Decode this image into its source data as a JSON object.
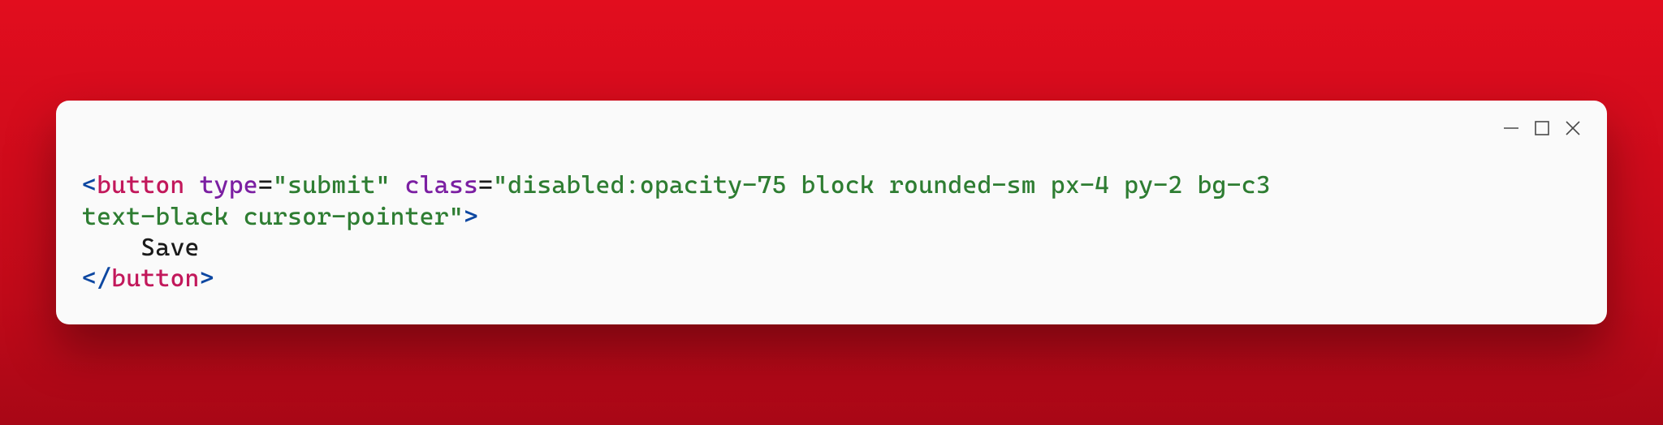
{
  "code": {
    "line1": {
      "open_angle": "<",
      "tag": "button",
      "space1": " ",
      "attr1_name": "type",
      "eq1": "=",
      "attr1_value": "\"submit\"",
      "space2": " ",
      "attr2_name": "class",
      "eq2": "=",
      "attr2_value_part1": "\"disabled:opacity-75 block rounded-sm px-4 py-2 bg-c3"
    },
    "line2": {
      "attr2_value_part2": "text-black cursor-pointer\"",
      "close_angle": ">"
    },
    "line3": {
      "indent": "    ",
      "text": "Save"
    },
    "line4": {
      "open_angle": "</",
      "tag": "button",
      "close_angle": ">"
    }
  }
}
